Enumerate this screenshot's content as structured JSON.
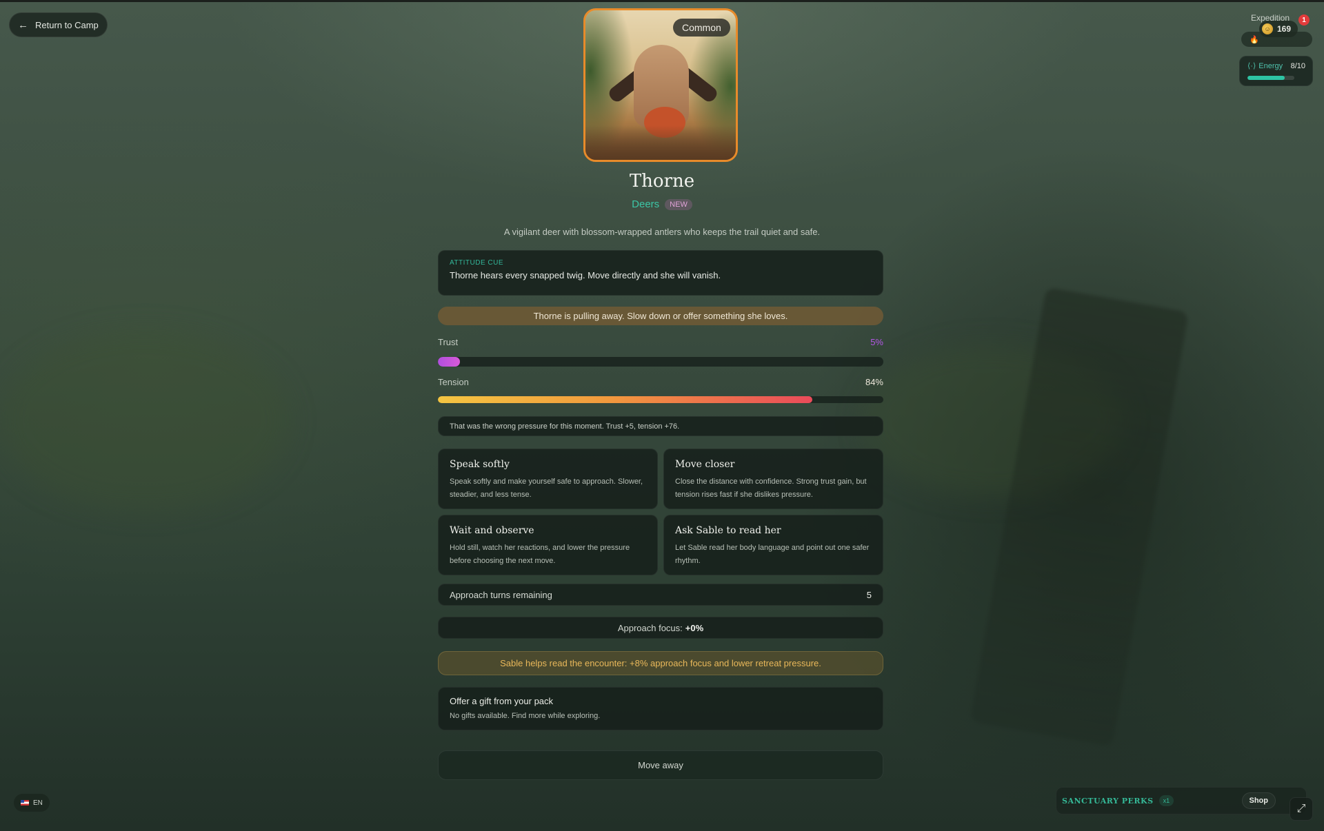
{
  "nav": {
    "back_label": "Return to Camp"
  },
  "top_right": {
    "section_label": "Expedition",
    "coins": "169",
    "notifications": "1",
    "energy_label": "Energy",
    "energy_value": "8/10",
    "energy_fraction": 0.8,
    "accent": "#2ec4a4"
  },
  "creature": {
    "rarity": "Common",
    "name": "Thorne",
    "species": "Deers",
    "new_badge": "NEW",
    "description": "A vigilant deer with blossom-wrapped antlers who keeps the trail quiet and safe."
  },
  "attitude": {
    "label": "ATTITUDE CUE",
    "text": "Thorne hears every snapped twig. Move directly and she will vanish."
  },
  "warning": "Thorne is pulling away. Slow down or offer something she loves.",
  "meters": {
    "trust_label": "Trust",
    "trust_value": "5%",
    "trust_fraction": 0.05,
    "tension_label": "Tension",
    "tension_value": "84%",
    "tension_fraction": 0.84
  },
  "feedback": "That was the wrong pressure for this moment. Trust +5, tension +76.",
  "actions": [
    {
      "title": "Speak softly",
      "desc": "Speak softly and make yourself safe to approach. Slower, steadier, and less tense."
    },
    {
      "title": "Move closer",
      "desc": "Close the distance with confidence. Strong trust gain, but tension rises fast if she dislikes pressure."
    },
    {
      "title": "Wait and observe",
      "desc": "Hold still, watch her reactions, and lower the pressure before choosing the next move."
    },
    {
      "title": "Ask Sable to read her",
      "desc": "Let Sable read her body language and point out one safer rhythm."
    }
  ],
  "turns": {
    "label": "Approach turns remaining",
    "value": "5"
  },
  "focus": {
    "label": "Approach focus:",
    "value": "+0%"
  },
  "sable_hint": "Sable helps read the encounter: +8% approach focus and lower retreat pressure.",
  "gift": {
    "title": "Offer a gift from your pack",
    "desc": "No gifts available. Find more while exploring."
  },
  "move_away": "Move away",
  "footer": {
    "lang": "EN",
    "perks_label": "SANCTUARY PERKS",
    "perks_count": "x1",
    "shop_label": "Shop"
  }
}
